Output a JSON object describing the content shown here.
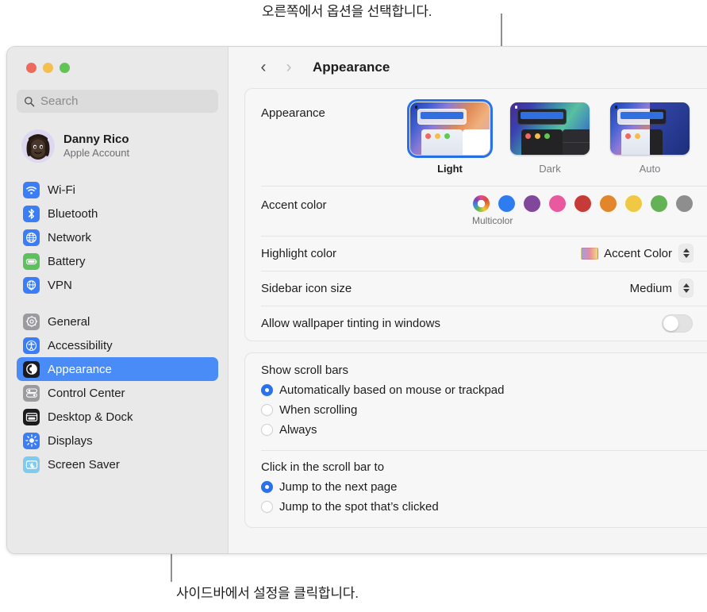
{
  "callouts": {
    "top": "오른쪽에서 옵션을 선택합니다.",
    "bottom": "사이드바에서 설정을 클릭합니다."
  },
  "window": {
    "traffic_lights": [
      "close",
      "minimize",
      "zoom"
    ]
  },
  "sidebar": {
    "search": {
      "placeholder": "Search",
      "value": ""
    },
    "account": {
      "name": "Danny Rico",
      "subtitle": "Apple Account"
    },
    "groups": [
      {
        "items": [
          {
            "label": "Wi-Fi",
            "icon": "wifi-icon",
            "color": "#3b7df4",
            "selected": false
          },
          {
            "label": "Bluetooth",
            "icon": "bluetooth-icon",
            "color": "#3b7df4",
            "selected": false
          },
          {
            "label": "Network",
            "icon": "globe-icon",
            "color": "#3b7df4",
            "selected": false
          },
          {
            "label": "Battery",
            "icon": "battery-icon",
            "color": "#5cc15c",
            "selected": false
          },
          {
            "label": "VPN",
            "icon": "vpn-globe-icon",
            "color": "#3b7df4",
            "selected": false
          }
        ]
      },
      {
        "items": [
          {
            "label": "General",
            "icon": "gear-icon",
            "color": "#9a9a9f",
            "selected": false
          },
          {
            "label": "Accessibility",
            "icon": "accessibility-icon",
            "color": "#3b7df4",
            "selected": false
          },
          {
            "label": "Appearance",
            "icon": "appearance-icon",
            "color": "#1c1c1e",
            "selected": true
          },
          {
            "label": "Control Center",
            "icon": "control-center-icon",
            "color": "#9a9a9f",
            "selected": false
          },
          {
            "label": "Desktop & Dock",
            "icon": "desktop-dock-icon",
            "color": "#1c1c1e",
            "selected": false
          },
          {
            "label": "Displays",
            "icon": "brightness-icon",
            "color": "#3b7df4",
            "selected": false
          },
          {
            "label": "Screen Saver",
            "icon": "screen-saver-icon",
            "color": "#7fcbf0",
            "selected": false
          }
        ]
      }
    ]
  },
  "header": {
    "back_icon": "chevron-left-icon",
    "forward_icon": "chevron-right-icon",
    "title": "Appearance"
  },
  "main": {
    "appearance": {
      "label": "Appearance",
      "options": [
        {
          "label": "Light",
          "selected": true
        },
        {
          "label": "Dark",
          "selected": false
        },
        {
          "label": "Auto",
          "selected": false
        }
      ]
    },
    "accent_color": {
      "label": "Accent color",
      "caption": "Multicolor",
      "swatches": [
        {
          "name": "multicolor",
          "color": "multicolor",
          "selected": true
        },
        {
          "name": "blue",
          "color": "#2f7cf0",
          "selected": false
        },
        {
          "name": "purple",
          "color": "#80479b",
          "selected": false
        },
        {
          "name": "pink",
          "color": "#e8599f",
          "selected": false
        },
        {
          "name": "red",
          "color": "#c63b37",
          "selected": false
        },
        {
          "name": "orange",
          "color": "#e2862c",
          "selected": false
        },
        {
          "name": "yellow",
          "color": "#f0c944",
          "selected": false
        },
        {
          "name": "green",
          "color": "#64b255",
          "selected": false
        },
        {
          "name": "graphite",
          "color": "#8e8e8e",
          "selected": false
        }
      ]
    },
    "highlight_color": {
      "label": "Highlight color",
      "value": "Accent Color"
    },
    "sidebar_icon_size": {
      "label": "Sidebar icon size",
      "value": "Medium"
    },
    "wallpaper_tinting": {
      "label": "Allow wallpaper tinting in windows",
      "state": "off"
    },
    "show_scroll_bars": {
      "title": "Show scroll bars",
      "options": [
        {
          "label": "Automatically based on mouse or trackpad",
          "selected": true
        },
        {
          "label": "When scrolling",
          "selected": false
        },
        {
          "label": "Always",
          "selected": false
        }
      ]
    },
    "click_scroll_bar": {
      "title": "Click in the scroll bar to",
      "options": [
        {
          "label": "Jump to the next page",
          "selected": true
        },
        {
          "label": "Jump to the spot that’s clicked",
          "selected": false
        }
      ]
    }
  },
  "colors": {
    "accent": "#4a8cf7",
    "selection_blue": "#2a72ec",
    "sidebar_bg": "#e9e9e9",
    "content_bg": "#f5f5f5"
  }
}
